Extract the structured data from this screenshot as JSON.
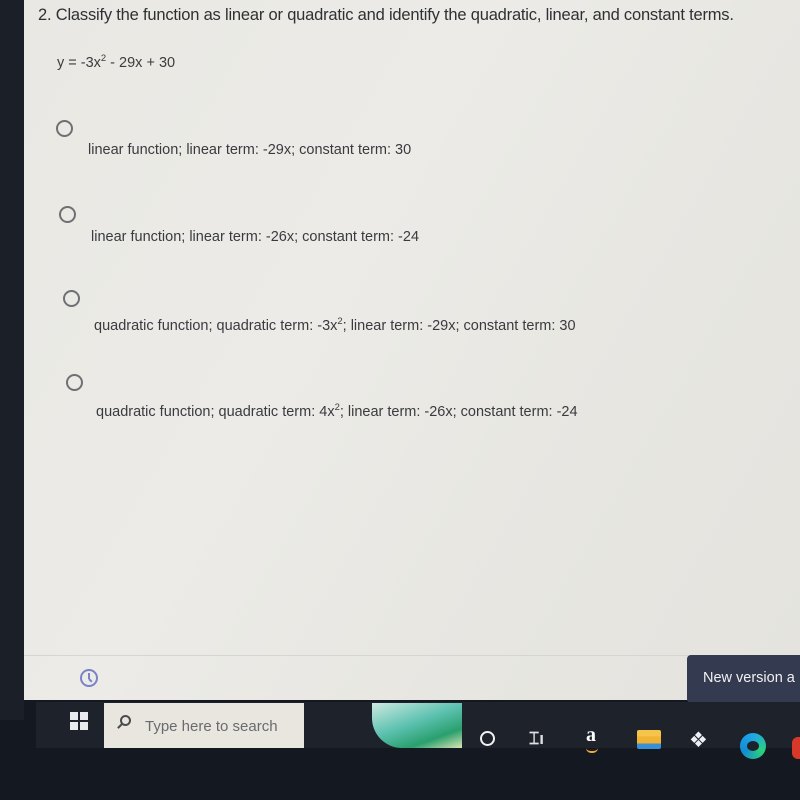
{
  "quiz": {
    "question": "2. Classify the function as linear or quadratic and identify the quadratic, linear, and constant terms.",
    "equation": {
      "prefix": "y = -3x",
      "exponent": "2",
      "suffix": " - 29x + 30"
    },
    "options": [
      {
        "selected": false,
        "text": "linear function; linear term: -29x; constant term: 30"
      },
      {
        "selected": false,
        "text": "linear function; linear term: -26x; constant term: -24"
      },
      {
        "selected": false,
        "before_exp": "quadratic function; quadratic term: -3x",
        "exponent": "2",
        "after_exp": "; linear term: -29x; constant term: 30"
      },
      {
        "selected": false,
        "before_exp": "quadratic function; quadratic term: 4x",
        "exponent": "2",
        "after_exp": "; linear term: -26x; constant term: -24"
      }
    ]
  },
  "footer": {
    "history_icon": "clock-icon",
    "toast_text": "New version a"
  },
  "taskbar": {
    "start_icon": "windows-logo-icon",
    "search_placeholder": "Type here to search",
    "apps": [
      {
        "name": "cortana",
        "icon": "circle-icon"
      },
      {
        "name": "task-view",
        "icon": "task-view-icon"
      },
      {
        "name": "amazon",
        "icon": "amazon-icon",
        "glyph": "a"
      },
      {
        "name": "file-explorer",
        "icon": "folder-icon"
      },
      {
        "name": "dropbox",
        "icon": "dropbox-icon",
        "glyph": "❖"
      },
      {
        "name": "edge",
        "icon": "edge-icon"
      }
    ],
    "task_view_glyph": "⌶ı"
  }
}
